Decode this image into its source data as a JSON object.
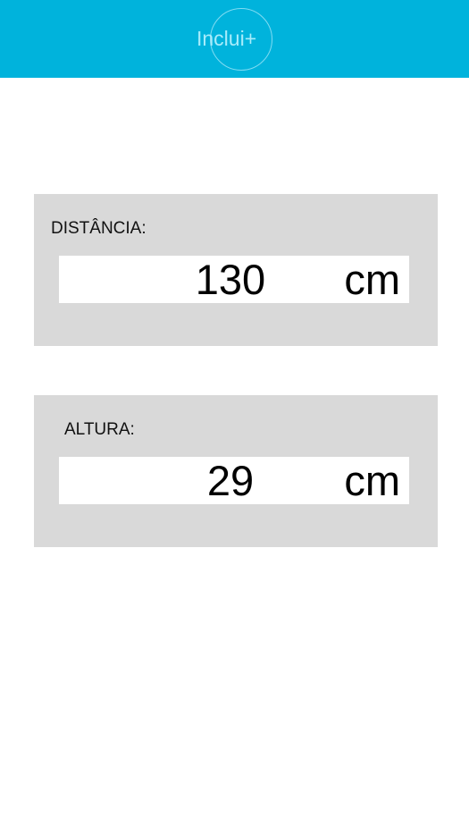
{
  "header": {
    "logo_text": "Inclui+",
    "background_color": "#00b3dc"
  },
  "distance": {
    "label": "DISTÂNCIA:",
    "value": "130",
    "unit": "cm"
  },
  "height": {
    "label": "ALTURA:",
    "value": "29",
    "unit": "cm"
  }
}
